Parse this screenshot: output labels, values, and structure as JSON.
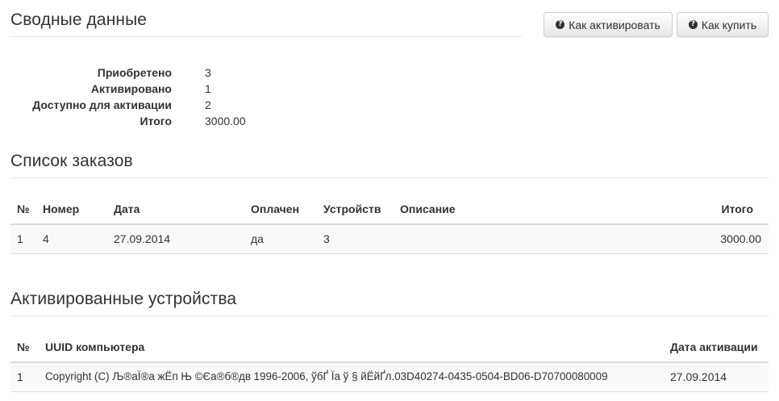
{
  "summary": {
    "title": "Сводные данные",
    "buttons": {
      "how_activate": "Как активировать",
      "how_buy": "Как купить"
    },
    "rows": [
      {
        "label": "Приобретено",
        "value": "3"
      },
      {
        "label": "Активировано",
        "value": "1"
      },
      {
        "label": "Доступно для активации",
        "value": "2"
      },
      {
        "label": "Итого",
        "value": "3000.00"
      }
    ]
  },
  "orders": {
    "title": "Список заказов",
    "columns": {
      "num": "№",
      "number": "Номер",
      "date": "Дата",
      "paid": "Оплачен",
      "devices": "Устройств",
      "description": "Описание",
      "total": "Итого"
    },
    "rows": [
      {
        "num": "1",
        "number": "4",
        "date": "27.09.2014",
        "paid": "да",
        "devices": "3",
        "description": "",
        "total": "3000.00"
      }
    ]
  },
  "devices": {
    "title": "Активированные устройства",
    "columns": {
      "num": "№",
      "uuid": "UUID компьютера",
      "activation_date": "Дата активации"
    },
    "rows": [
      {
        "num": "1",
        "uuid": "Copyright (C) Љ®аЇ®а жЁп Њ ©Єа®б®дв 1996-2006, ўбҐ Їа ў  § йЁйҐл.03D40274-0435-0504-BD06-D70700080009",
        "activation_date": "27.09.2014"
      }
    ]
  }
}
